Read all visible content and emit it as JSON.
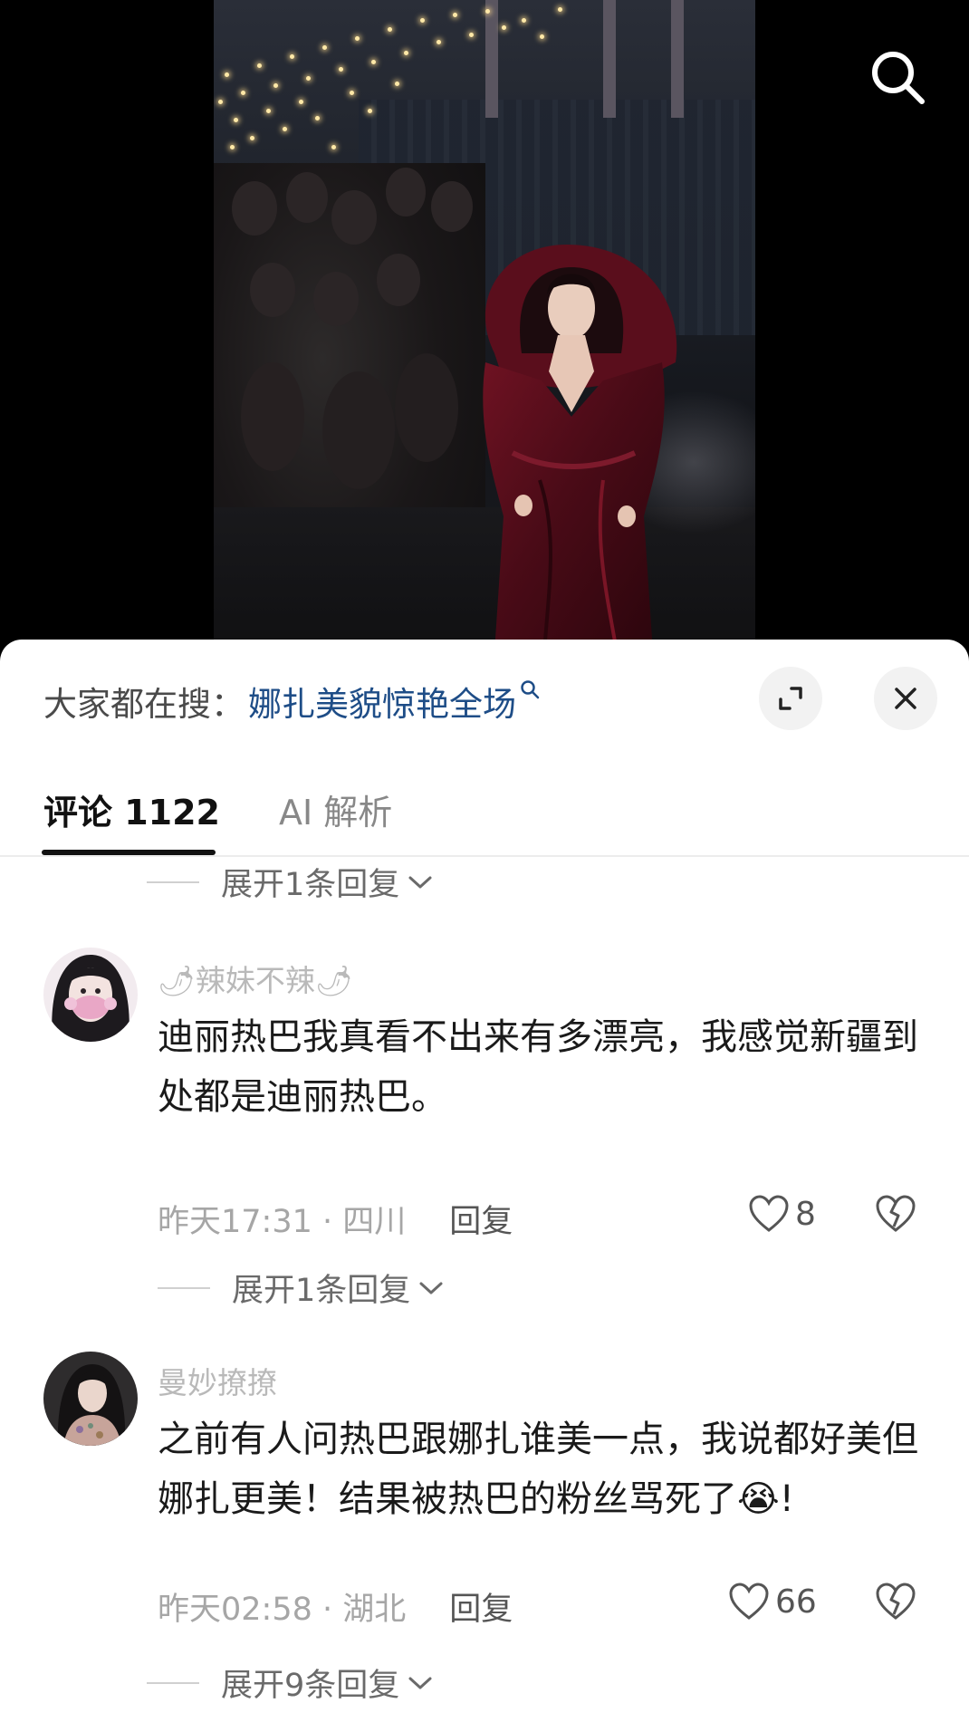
{
  "top": {
    "search_icon": "search-icon"
  },
  "panel": {
    "hot_search": {
      "prefix": "大家都在搜：",
      "query": "娜扎美貌惊艳全场"
    },
    "buttons": {
      "expand_icon": "expand-icon",
      "close_icon": "close-icon"
    },
    "tabs": [
      {
        "label": "评论 1122",
        "active": true
      },
      {
        "label": "AI 解析",
        "active": false
      }
    ],
    "top_expand": "展开1条回复",
    "comments": [
      {
        "username": "🌶辣妹不辣🌶",
        "text": "迪丽热巴我真看不出来有多漂亮，我感觉新疆到处都是迪丽热巴。",
        "time": "昨天17:31 · 四川",
        "reply": "回复",
        "likes": "8",
        "expand": "展开1条回复"
      },
      {
        "username": "曼妙撩撩",
        "text": "之前有人问热巴跟娜扎谁美一点，我说都好美但娜扎更美！结果被热巴的粉丝骂死了",
        "emoji": "😭",
        "text_tail": "!",
        "time": "昨天02:58 · 湖北",
        "reply": "回复",
        "likes": "66",
        "expand": "展开9条回复"
      }
    ]
  },
  "colors": {
    "link": "#1e4d87",
    "muted": "#a6a6a6",
    "text": "#1a1a1a"
  }
}
